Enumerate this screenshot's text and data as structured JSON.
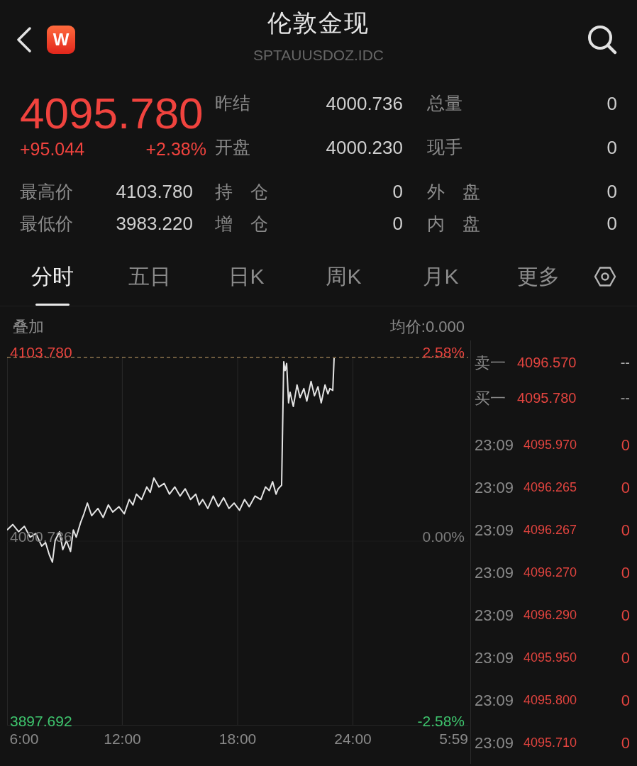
{
  "header": {
    "logo": "W",
    "title": "伦敦金现",
    "code": "SPTAUUSDOZ.IDC"
  },
  "quote": {
    "price": "4095.780",
    "change": "+95.044",
    "change_pct": "+2.38%",
    "rising": true
  },
  "stats_top": [
    {
      "cells": [
        {
          "label": "昨结",
          "value": "4000.736"
        },
        {
          "label": "总量",
          "value": "0"
        }
      ]
    },
    {
      "cells": [
        {
          "label": "开盘",
          "value": "4000.230"
        },
        {
          "label": "现手",
          "value": "0"
        }
      ]
    }
  ],
  "stats_bottom": [
    {
      "cells": [
        {
          "label": "最高价",
          "value": "4103.780"
        },
        {
          "label": "持　仓",
          "value": "0"
        },
        {
          "label": "外　盘",
          "value": "0"
        }
      ]
    },
    {
      "cells": [
        {
          "label": "最低价",
          "value": "3983.220"
        },
        {
          "label": "增　仓",
          "value": "0"
        },
        {
          "label": "内　盘",
          "value": "0"
        }
      ]
    }
  ],
  "tabs": [
    {
      "label": "分时",
      "selected": true
    },
    {
      "label": "五日",
      "selected": false
    },
    {
      "label": "日K",
      "selected": false
    },
    {
      "label": "周K",
      "selected": false
    },
    {
      "label": "月K",
      "selected": false
    },
    {
      "label": "更多",
      "selected": false
    }
  ],
  "chart": {
    "overlay": "叠加",
    "avg_price": "均价:0.000",
    "percent_labels": [
      "2.58%",
      "0.00%",
      "-2.58%"
    ],
    "x_end_label": "5:59",
    "chart_data": {
      "type": "line",
      "grid": true,
      "x": [
        6.0,
        6.3,
        6.6,
        6.9,
        7.2,
        7.5,
        7.8,
        8.0,
        8.2,
        8.36,
        8.5,
        8.73,
        8.9,
        9.09,
        9.3,
        9.45,
        9.6,
        9.82,
        10.0,
        10.18,
        10.4,
        10.73,
        11.0,
        11.27,
        11.5,
        11.82,
        12.1,
        12.36,
        12.55,
        12.73,
        13.0,
        13.27,
        13.45,
        13.64,
        13.9,
        14.18,
        14.45,
        14.73,
        15.0,
        15.27,
        15.55,
        15.82,
        16.0,
        16.18,
        16.45,
        16.73,
        17.0,
        17.27,
        17.55,
        17.82,
        18.1,
        18.36,
        18.6,
        18.91,
        19.2,
        19.45,
        19.65,
        19.82,
        20.0,
        20.11,
        20.29,
        20.4,
        20.47,
        20.55,
        20.65,
        20.73,
        20.9,
        21.09,
        21.25,
        21.45,
        21.6,
        21.82,
        22.0,
        22.18,
        22.35,
        22.55,
        22.7,
        22.8,
        22.95,
        23.02
      ],
      "values": [
        4007,
        4010,
        4006,
        4009,
        4003,
        4005,
        3998,
        4000,
        3993,
        3989,
        4001,
        4006,
        3996,
        4001,
        3995,
        4007,
        4003,
        4011,
        4016,
        4022,
        4015,
        4019,
        4014,
        4021,
        4017,
        4020,
        4016,
        4024,
        4021,
        4027,
        4024,
        4031,
        4028,
        4036,
        4031,
        4033,
        4027,
        4031,
        4026,
        4030,
        4024,
        4027,
        4021,
        4024,
        4019,
        4026,
        4020,
        4025,
        4019,
        4022,
        4018,
        4024,
        4020,
        4026,
        4024,
        4031,
        4029,
        4034,
        4027,
        4030,
        4032,
        4101,
        4096,
        4100,
        4078,
        4084,
        4076,
        4088,
        4081,
        4086,
        4079,
        4090,
        4082,
        4087,
        4078,
        4088,
        4083,
        4086,
        4085,
        4103
      ],
      "xlim": [
        6,
        30
      ],
      "ylim": [
        3897.692,
        4103.78
      ],
      "xticks": [
        {
          "value": 6,
          "label": "6:00"
        },
        {
          "value": 12,
          "label": "12:00"
        },
        {
          "value": 18,
          "label": "18:00"
        },
        {
          "value": 24,
          "label": "24:00"
        }
      ],
      "yticks": [
        {
          "value": 4103.78,
          "label": "4103.780"
        },
        {
          "value": 4000.736,
          "label": "4000.736"
        },
        {
          "value": 3897.692,
          "label": "3897.692"
        }
      ]
    }
  },
  "order_book": [
    {
      "label": "卖一",
      "price": "4096.570",
      "volume": "--"
    },
    {
      "label": "买一",
      "price": "4095.780",
      "volume": "--"
    }
  ],
  "trades": [
    {
      "time": "23:09",
      "price": "4095.970",
      "volume": "0"
    },
    {
      "time": "23:09",
      "price": "4096.265",
      "volume": "0"
    },
    {
      "time": "23:09",
      "price": "4096.267",
      "volume": "0"
    },
    {
      "time": "23:09",
      "price": "4096.270",
      "volume": "0"
    },
    {
      "time": "23:09",
      "price": "4096.290",
      "volume": "0"
    },
    {
      "time": "23:09",
      "price": "4095.950",
      "volume": "0"
    },
    {
      "time": "23:09",
      "price": "4095.800",
      "volume": "0"
    },
    {
      "time": "23:09",
      "price": "4095.710",
      "volume": "0"
    }
  ]
}
